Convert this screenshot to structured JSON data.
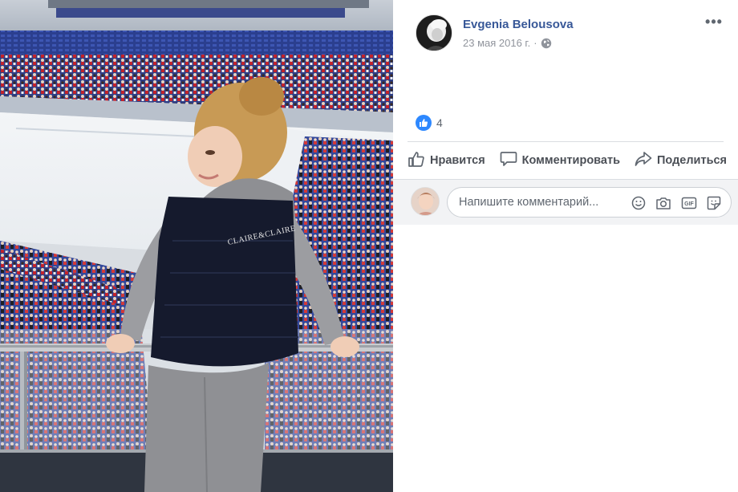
{
  "post": {
    "author_name": "Evgenia Belousova",
    "date": "23 мая 2016 г.",
    "separator": "·",
    "privacy_icon": "globe-icon",
    "more_label": "•••"
  },
  "photo": {
    "vest_logo": "CLAIRE&CLAIRE"
  },
  "reactions": {
    "icon": "thumbs-up-icon",
    "count": "4"
  },
  "actions": {
    "like_label": "Нравится",
    "comment_label": "Комментировать",
    "share_label": "Поделиться"
  },
  "comment": {
    "placeholder": "Напишите комментарий...",
    "icons": [
      "emoji-icon",
      "camera-icon",
      "gif-icon",
      "sticker-icon"
    ]
  },
  "colors": {
    "link_blue": "#385898",
    "like_blue": "#2d88ff",
    "text_grey": "#606770"
  }
}
